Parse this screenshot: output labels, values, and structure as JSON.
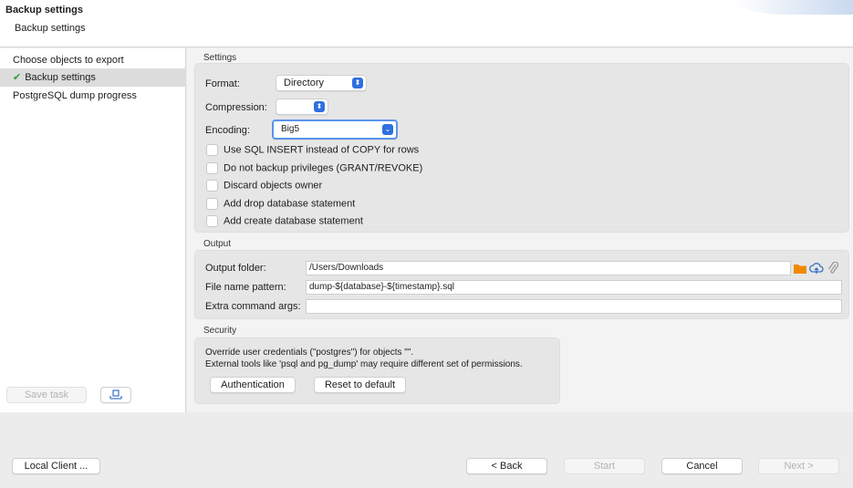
{
  "header": {
    "title": "Backup settings",
    "subtitle": "Backup settings"
  },
  "sidebar": {
    "items": [
      {
        "label": "Choose objects to export",
        "checked": false,
        "selected": false
      },
      {
        "label": "Backup settings",
        "checked": true,
        "selected": true
      },
      {
        "label": "PostgreSQL dump progress",
        "checked": false,
        "selected": false
      }
    ],
    "save_task_label": "Save task",
    "task_icon": "task-tray-icon"
  },
  "settings": {
    "section_label": "Settings",
    "format_label": "Format:",
    "format_value": "Directory",
    "compression_label": "Compression:",
    "compression_value": "",
    "encoding_label": "Encoding:",
    "encoding_value": "Big5",
    "checkboxes": [
      {
        "label": "Use SQL INSERT instead of COPY for rows",
        "checked": false
      },
      {
        "label": "Do not backup privileges (GRANT/REVOKE)",
        "checked": false
      },
      {
        "label": "Discard objects owner",
        "checked": false
      },
      {
        "label": "Add drop database statement",
        "checked": false
      },
      {
        "label": "Add create database statement",
        "checked": false
      }
    ]
  },
  "output": {
    "section_label": "Output",
    "folder_label": "Output folder:",
    "folder_value": "/Users/Downloads",
    "pattern_label": "File name pattern:",
    "pattern_value": "dump-${database}-${timestamp}.sql",
    "extra_label": "Extra command args:",
    "extra_value": ""
  },
  "security": {
    "section_label": "Security",
    "line1": "Override user credentials (\"postgres\") for objects \"\".",
    "line2": "External tools like 'psql and pg_dump' may require different set of permissions.",
    "auth_label": "Authentication",
    "reset_label": "Reset to default"
  },
  "footer": {
    "local_client_label": "Local Client ...",
    "back_label": "< Back",
    "start_label": "Start",
    "cancel_label": "Cancel",
    "next_label": "Next >"
  },
  "colors": {
    "accent": "#2f6fe0",
    "check": "#2e9e3e",
    "folder": "#f08a00"
  }
}
